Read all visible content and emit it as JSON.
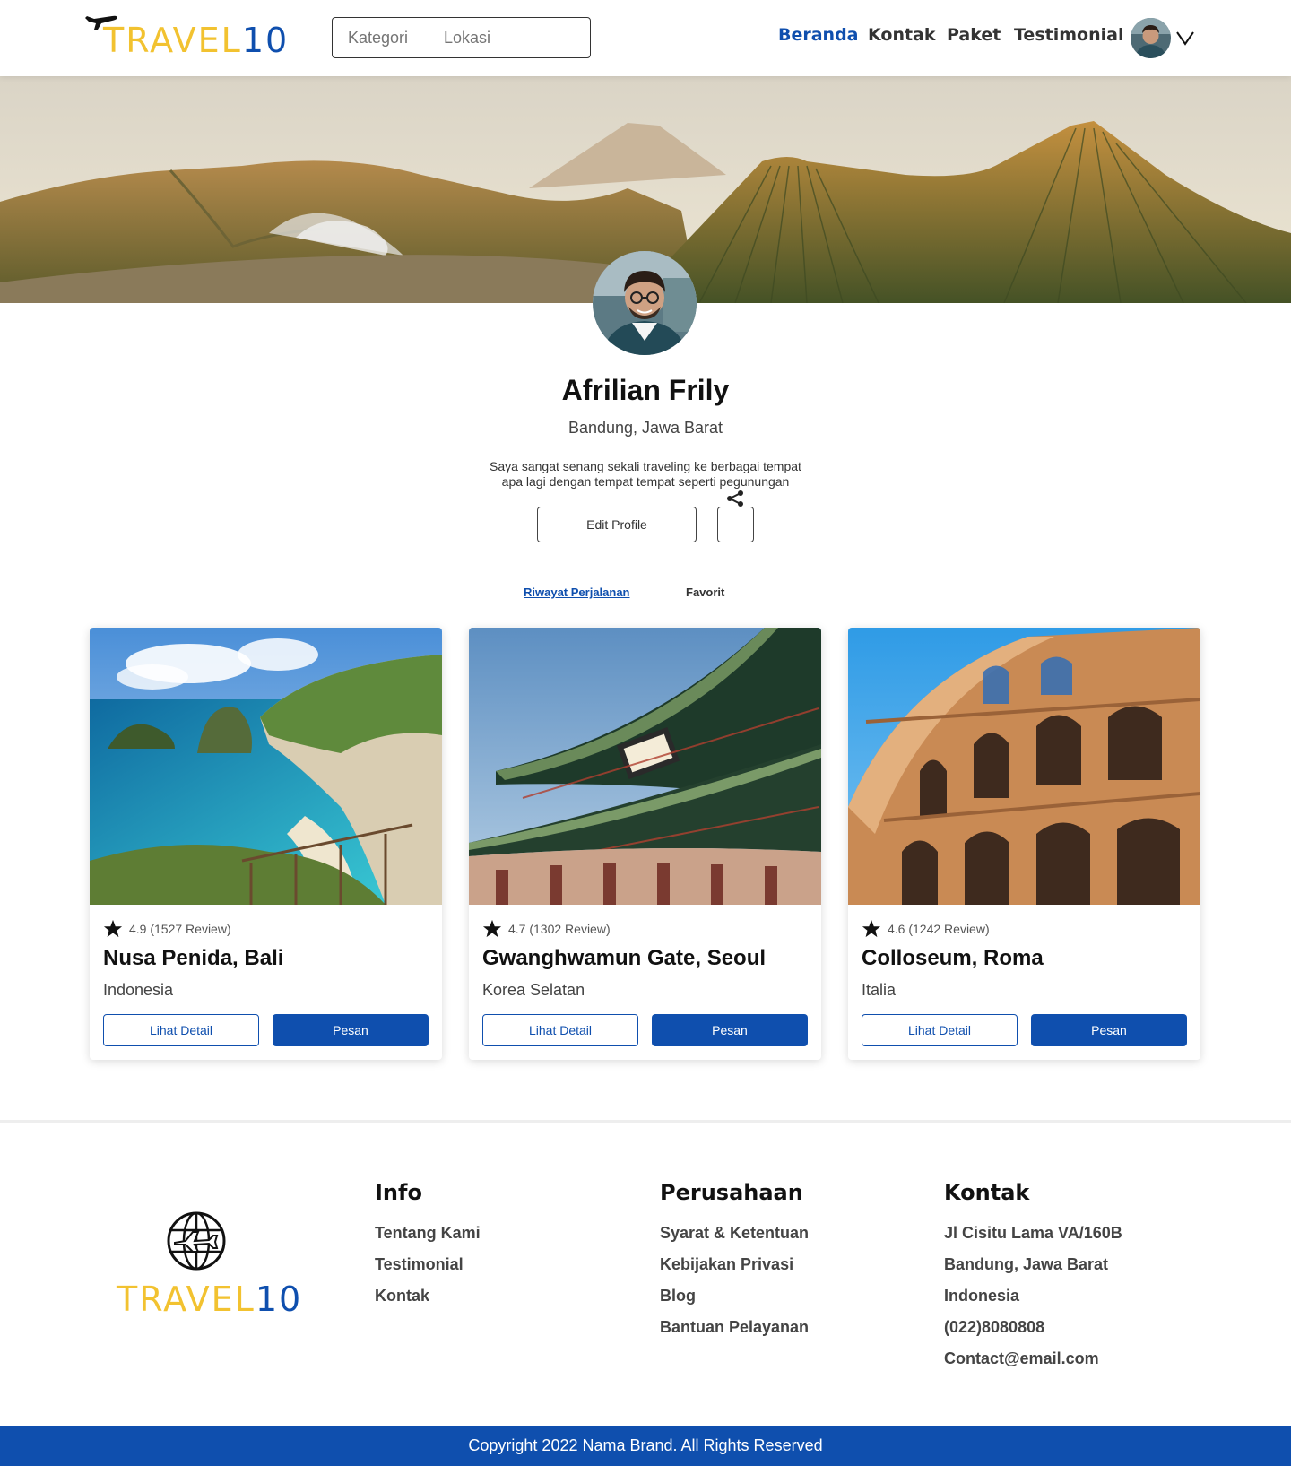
{
  "brand": {
    "part1": "TRAVEL",
    "part2": "10"
  },
  "search": {
    "category_placeholder": "Kategori",
    "location_placeholder": "Lokasi"
  },
  "nav": {
    "items": [
      "Beranda",
      "Kontak",
      "Paket",
      "Testimonial"
    ],
    "active": "Beranda"
  },
  "profile": {
    "name": "Afrilian Frily",
    "location": "Bandung, Jawa Barat",
    "bio_line1": "Saya sangat senang sekali traveling ke berbagai tempat",
    "bio_line2": "apa lagi dengan tempat tempat seperti pegunungan",
    "edit_label": "Edit Profile"
  },
  "tabs": [
    "Riwayat Perjalanan",
    "Favorit"
  ],
  "cards": [
    {
      "rating": "4.9 (1527 Review)",
      "name": "Nusa Penida, Bali",
      "country": "Indonesia",
      "detail_label": "Lihat Detail",
      "order_label": "Pesan"
    },
    {
      "rating": "4.7 (1302 Review)",
      "name": "Gwanghwamun Gate, Seoul",
      "country": "Korea Selatan",
      "detail_label": "Lihat Detail",
      "order_label": "Pesan"
    },
    {
      "rating": "4.6 (1242 Review)",
      "name": "Colloseum, Roma",
      "country": "Italia",
      "detail_label": "Lihat Detail",
      "order_label": "Pesan"
    }
  ],
  "footer": {
    "info": {
      "title": "Info",
      "links": [
        "Tentang Kami",
        "Testimonial",
        "Kontak"
      ]
    },
    "company": {
      "title": "Perusahaan",
      "links": [
        "Syarat & Ketentuan",
        "Kebijakan Privasi",
        "Blog",
        "Bantuan Pelayanan"
      ]
    },
    "contact": {
      "title": "Kontak",
      "lines": [
        "Jl Cisitu Lama VA/160B",
        "Bandung, Jawa Barat",
        "Indonesia",
        "(022)8080808",
        "Contact@email.com"
      ]
    },
    "copyright": "Copyright 2022 Nama Brand. All Rights Reserved"
  },
  "colors": {
    "primary": "#0f4fae",
    "brand_yellow": "#f2c230"
  },
  "icons": [
    "plane-icon",
    "search-icon",
    "chevron-down-icon",
    "share-icon",
    "star-icon",
    "globe-plane-icon"
  ]
}
